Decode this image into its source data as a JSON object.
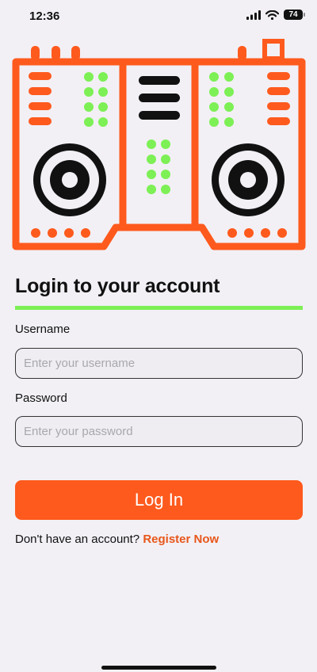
{
  "status_bar": {
    "time": "12:36",
    "battery_level": "74",
    "icons": [
      "signal-icon",
      "wifi-icon",
      "battery-icon"
    ]
  },
  "hero": {
    "image": "dj-mixer-icon",
    "colors": {
      "frame": "#fe5a1d",
      "accent": "#7df055",
      "dark": "#111111"
    }
  },
  "login": {
    "title": "Login to your account",
    "username_label": "Username",
    "username_placeholder": "Enter your username",
    "password_label": "Password",
    "password_placeholder": "Enter your password",
    "button_label": "Log In",
    "register_prompt": "Don't have an account?",
    "register_link": "Register Now"
  },
  "colors": {
    "background": "#f2f0f5",
    "primary": "#fe5a1d",
    "underline": "#7df055",
    "link": "#e8561a"
  }
}
